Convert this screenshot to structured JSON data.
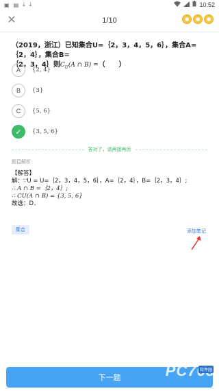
{
  "status_bar": {
    "left_icons": [
      "app-icon",
      "gallery-icon",
      "download-icon",
      "download-icon"
    ],
    "time": "10:52"
  },
  "header": {
    "progress": "1/10",
    "coins": [
      "",
      "",
      ""
    ]
  },
  "question": {
    "prefix": "（2019，浙江）已知集合U=｛2，3，4，5，6｝，集合A=｛2，4｝，集合B=",
    "line2_pre": "｛2，3，4｝则",
    "line2_math": "C",
    "line2_sub": "U",
    "line2_math2": "(A ∩ B) =",
    "line2_post": "（　　）"
  },
  "options": [
    {
      "letter": "A",
      "text": "{2, 4}",
      "correct": false
    },
    {
      "letter": "B",
      "text": "{3}",
      "correct": false
    },
    {
      "letter": "C",
      "text": "{5, 6}",
      "correct": false
    },
    {
      "letter": "✓",
      "text": "{3, 5, 6}",
      "correct": true
    }
  ],
  "result_text": "答对了，请再接再厉",
  "analysis_label": "题目解析",
  "solution": {
    "heading": "【解答】",
    "line1": "解：∵U = U=｛2，3，4，5，6｝，A=｛2，4｝，B=｛2，3，4｝;",
    "line2": "∴ A ∩ B =｛2，4｝;",
    "line3": "∴ CU(A ∩ B) = {3, 5, 6}",
    "line4": "故选：D．"
  },
  "tag": "集合",
  "add_note": "添加笔记",
  "next_button": "下一题",
  "watermark": "PC768",
  "watermark_badge": "软件园"
}
